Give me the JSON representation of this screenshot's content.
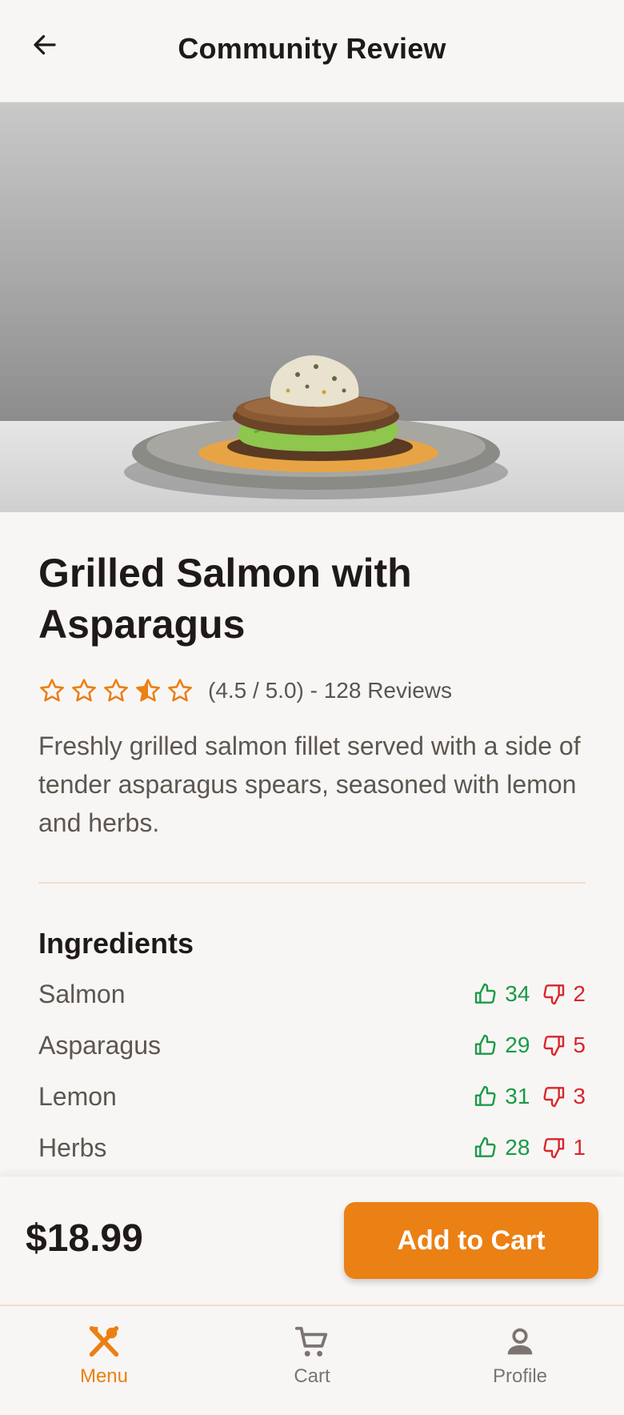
{
  "header": {
    "title": "Community Review"
  },
  "dish": {
    "title": "Grilled Salmon with Asparagus",
    "rating": 4.5,
    "rating_text": "(4.5 / 5.0) - 128 Reviews",
    "description": "Freshly grilled salmon fillet served with a side of tender asparagus spears, seasoned with lemon and herbs."
  },
  "ingredients": {
    "title": "Ingredients",
    "items": [
      {
        "name": "Salmon",
        "up": "34",
        "down": "2"
      },
      {
        "name": "Asparagus",
        "up": "29",
        "down": "5"
      },
      {
        "name": "Lemon",
        "up": "31",
        "down": "3"
      },
      {
        "name": "Herbs",
        "up": "28",
        "down": "1"
      }
    ]
  },
  "cart": {
    "price": "$18.99",
    "button_label": "Add to Cart"
  },
  "nav": {
    "items": [
      {
        "label": "Menu",
        "icon": "fork-knife-icon",
        "active": true
      },
      {
        "label": "Cart",
        "icon": "cart-icon",
        "active": false
      },
      {
        "label": "Profile",
        "icon": "person-icon",
        "active": false
      }
    ]
  },
  "colors": {
    "accent": "#eb8014",
    "upvote": "#1a9a48",
    "downvote": "#d8262e"
  }
}
